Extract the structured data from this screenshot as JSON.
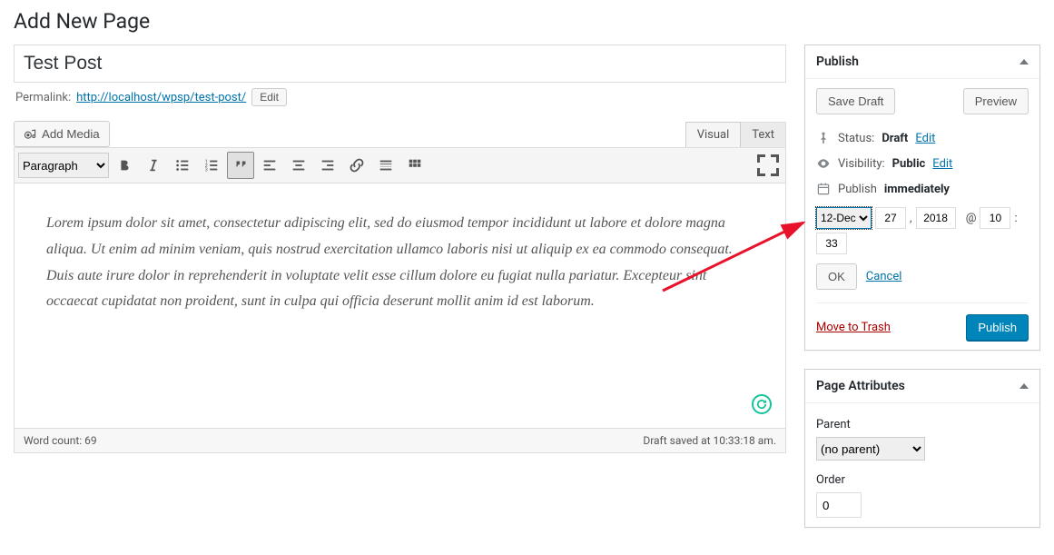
{
  "page_heading": "Add New Page",
  "title_value": "Test Post",
  "permalink": {
    "label": "Permalink:",
    "url": "http://localhost/wpsp/test-post/",
    "edit": "Edit"
  },
  "add_media": "Add Media",
  "editor_tabs": {
    "visual": "Visual",
    "text": "Text"
  },
  "format_select": "Paragraph",
  "content": "Lorem ipsum dolor sit amet, consectetur adipiscing elit, sed do eiusmod tempor incididunt ut labore et dolore magna aliqua. Ut enim ad minim veniam, quis nostrud exercitation ullamco laboris nisi ut aliquip ex ea commodo consequat. Duis aute irure dolor in reprehenderit in voluptate velit esse cillum dolore eu fugiat nulla pariatur. Excepteur sint occaecat cupidatat non proident, sunt in culpa qui officia deserunt mollit anim id est laborum.",
  "statusbar": {
    "wordcount_label": "Word count: 69",
    "saved": "Draft saved at 10:33:18 am."
  },
  "publish_box": {
    "title": "Publish",
    "save_draft": "Save Draft",
    "preview": "Preview",
    "status": {
      "label": "Status:",
      "value": "Draft",
      "edit": "Edit"
    },
    "visibility": {
      "label": "Visibility:",
      "value": "Public",
      "edit": "Edit"
    },
    "schedule": {
      "label": "Publish",
      "value": "immediately",
      "month": "12-Dec",
      "day": "27",
      "year": "2018",
      "at": "@",
      "hour": "10",
      "min": "33",
      "sep": ":"
    },
    "ok": "OK",
    "cancel": "Cancel",
    "trash": "Move to Trash",
    "publish_btn": "Publish"
  },
  "attributes_box": {
    "title": "Page Attributes",
    "parent_label": "Parent",
    "parent_value": "(no parent)",
    "order_label": "Order",
    "order_value": "0"
  }
}
